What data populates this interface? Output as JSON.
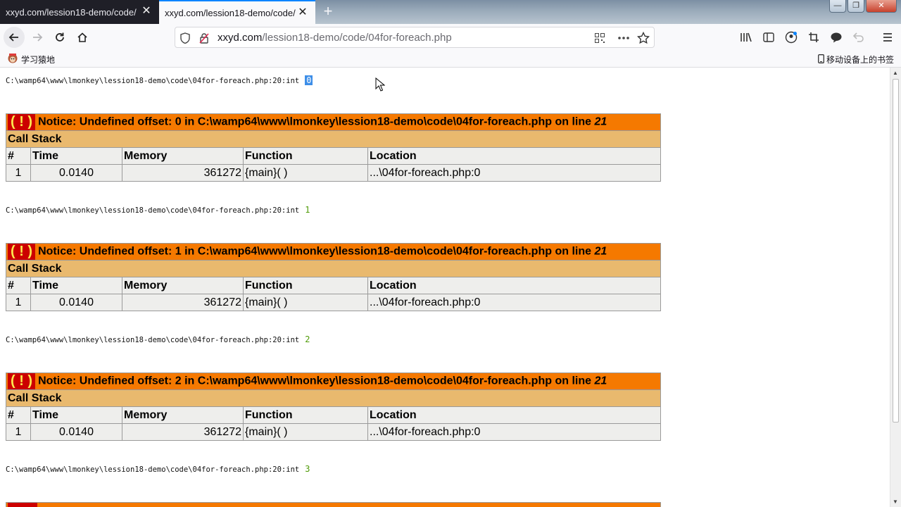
{
  "tabs": [
    {
      "label": "xxyd.com/lession18-demo/code/"
    },
    {
      "label": "xxyd.com/lession18-demo/code/"
    }
  ],
  "window_controls": {
    "minimize": "—",
    "restore": "❐",
    "close": "✕"
  },
  "address": {
    "host": "xxyd.com",
    "path": "/lession18-demo/code/04for-foreach.php"
  },
  "bookmarks": {
    "folder": "学习猿地",
    "mobile": "移动设备上的书签"
  },
  "dumps": [
    {
      "prefix": "C:\\wamp64\\www\\lmonkey\\lession18-demo\\code\\04for-foreach.php:20:int",
      "value": "0"
    },
    {
      "prefix": "C:\\wamp64\\www\\lmonkey\\lession18-demo\\code\\04for-foreach.php:20:int",
      "value": "1"
    },
    {
      "prefix": "C:\\wamp64\\www\\lmonkey\\lession18-demo\\code\\04for-foreach.php:20:int",
      "value": "2"
    },
    {
      "prefix": "C:\\wamp64\\www\\lmonkey\\lession18-demo\\code\\04for-foreach.php:20:int",
      "value": "3"
    }
  ],
  "notices": [
    {
      "bang": "( ! )",
      "message": "Notice: Undefined offset: 0 in C:\\wamp64\\www\\lmonkey\\lession18-demo\\code\\04for-foreach.php on line ",
      "line": "21"
    },
    {
      "bang": "( ! )",
      "message": "Notice: Undefined offset: 1 in C:\\wamp64\\www\\lmonkey\\lession18-demo\\code\\04for-foreach.php on line ",
      "line": "21"
    },
    {
      "bang": "( ! )",
      "message": "Notice: Undefined offset: 2 in C:\\wamp64\\www\\lmonkey\\lession18-demo\\code\\04for-foreach.php on line ",
      "line": "21"
    }
  ],
  "call_stack": {
    "title": "Call Stack",
    "columns": [
      "#",
      "Time",
      "Memory",
      "Function",
      "Location"
    ],
    "row": [
      "1",
      "0.0140",
      "361272",
      "{main}( )",
      "...\\04for-foreach.php:0"
    ]
  },
  "colors": {
    "notice_header": "#f57900",
    "call_stack": "#e9b96e",
    "cell": "#eeeeec",
    "int_value": "#4e9a06"
  }
}
